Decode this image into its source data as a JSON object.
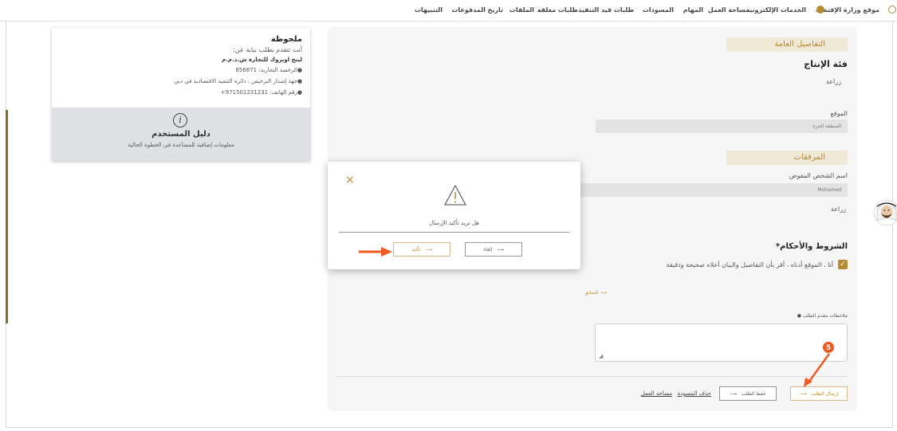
{
  "topnav": {
    "ministry_site": "موقع وزارة الإقتصاد",
    "eservices": "الخدمات الإلكترونية",
    "workspace": "مساحة العمل",
    "tasks": "المهام",
    "drafts": "المسودات",
    "in_progress": "طلبات قيد التنفيذ",
    "closed": "طلبات مغلقة",
    "files": "الملفات",
    "payments": "تاريخ المدفوعات",
    "notifications": "التنبيهات"
  },
  "note": {
    "title": "ملحوظة",
    "line1": "أنت تتقدم بطلب نيابة عن:",
    "company": "لينج اوبروك للتجارة ش.ذ.م.م",
    "license": "●الرخصة التجارية: 656671",
    "authority": "●جهة إصدار الترخيص : دائرة التنمية الاقتصادية في دبي",
    "phone": "●رقم الهاتف: 971501231231+",
    "guide_icon": "info-icon",
    "guide_title": "دليل المستخدم",
    "guide_sub": "معلومات إضافية للمساعدة في الخطوة الحالية"
  },
  "form": {
    "general_header": "التفاصيل العامة",
    "category_label": "فئة الإنتاج",
    "category_value": "زراعة",
    "location_label": "الموقع",
    "location_value": "المنطقة الحرة",
    "attachments_header": "المرفقات",
    "delegate_label": "اسم الشخص المفوض",
    "delegate_value": "Mohamed",
    "attach_value": "زراعة",
    "terms_label": "الشروط والأحكام*",
    "terms_text": "أنا ، الموقع أدناه ، أقر بأن التفاصيل والبيان أعلاه صحيحة ودقيقة",
    "prev_label": "السابق",
    "notes_label": "ملاحظات مقدم الطلب",
    "submit_label": "إرسال الطلب",
    "save_label": "حفظ الطلب",
    "delete_draft": "حذف المسودة",
    "workspace_link": "مساحة العمل",
    "step_badge": "5"
  },
  "modal": {
    "message": "هل تريد تأكيد الإرسال",
    "cancel_label": "إلغاء",
    "confirm_label": "تأكيد",
    "close_glyph": "×"
  },
  "colors": {
    "accent_gold": "#b68a35",
    "annotation_orange": "#ee5a1f"
  }
}
